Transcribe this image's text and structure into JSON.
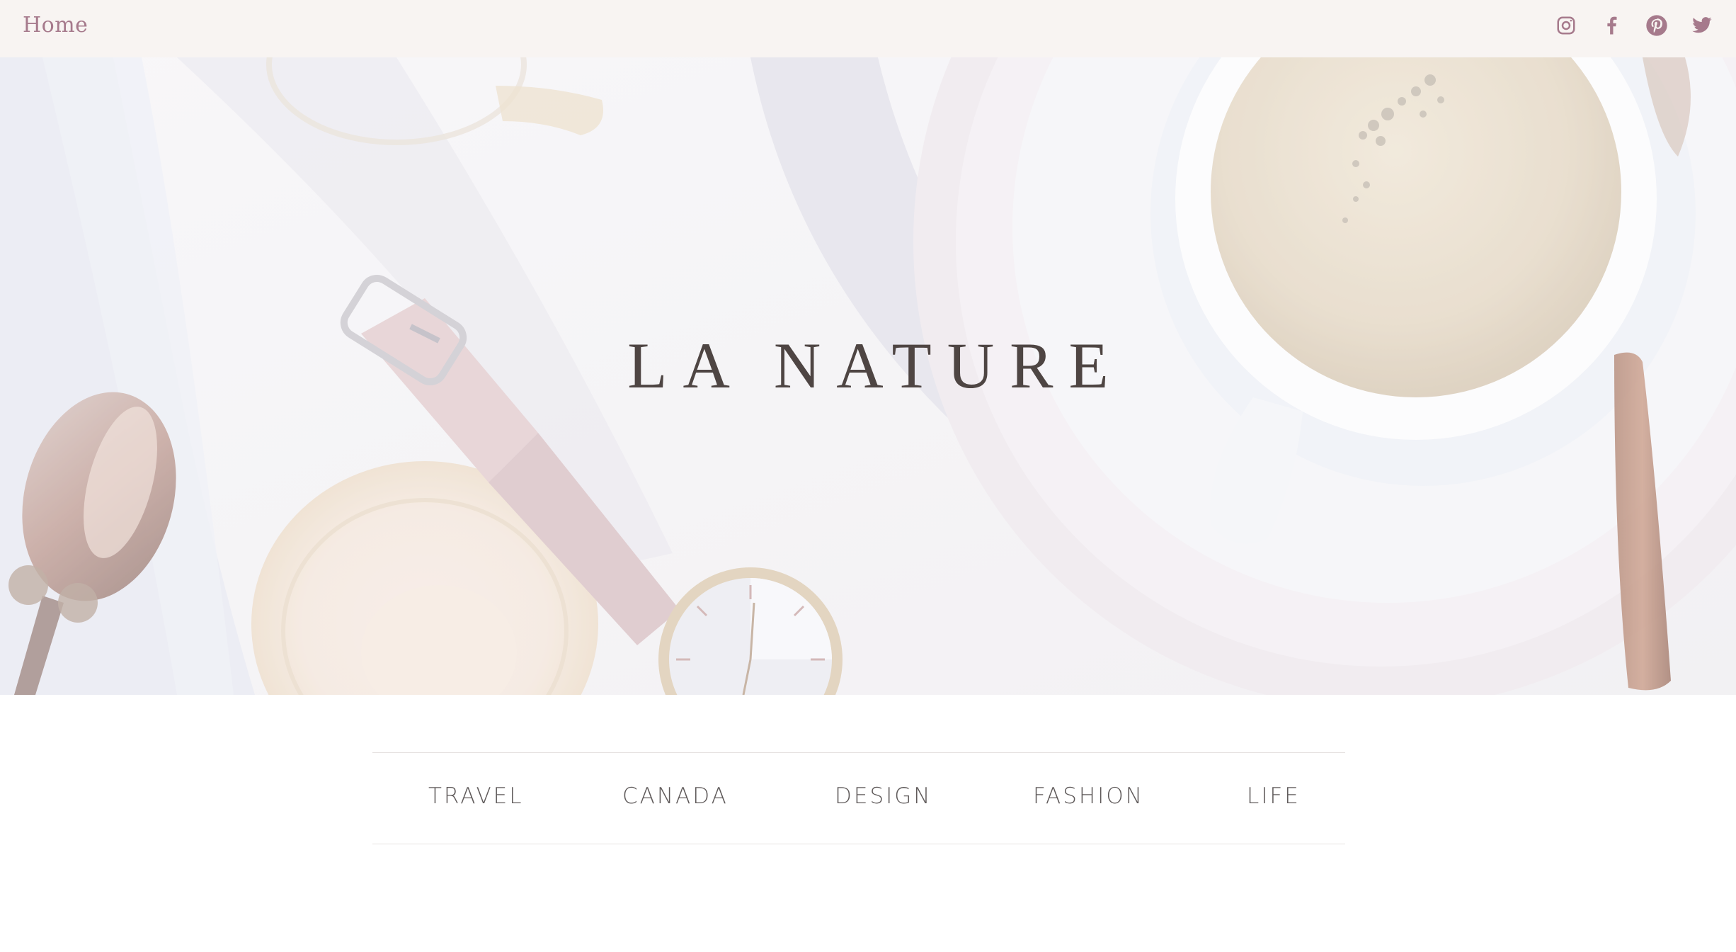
{
  "header": {
    "home_label": "Home",
    "social": [
      {
        "name": "instagram-icon"
      },
      {
        "name": "facebook-icon"
      },
      {
        "name": "pinterest-icon"
      },
      {
        "name": "twitter-icon"
      }
    ],
    "icon_color": "#a67a8c",
    "background": "#f8f4f2"
  },
  "hero": {
    "title": "LA NATURE",
    "image_description_icon": "coffee-watch-photo"
  },
  "categories": [
    {
      "label": "TRAVEL"
    },
    {
      "label": "CANADA"
    },
    {
      "label": "DESIGN"
    },
    {
      "label": "FASHION"
    },
    {
      "label": "LIFE"
    }
  ],
  "colors": {
    "accent": "#a67a8c",
    "title_text": "#4e4543",
    "nav_text": "#5f5a5a"
  }
}
